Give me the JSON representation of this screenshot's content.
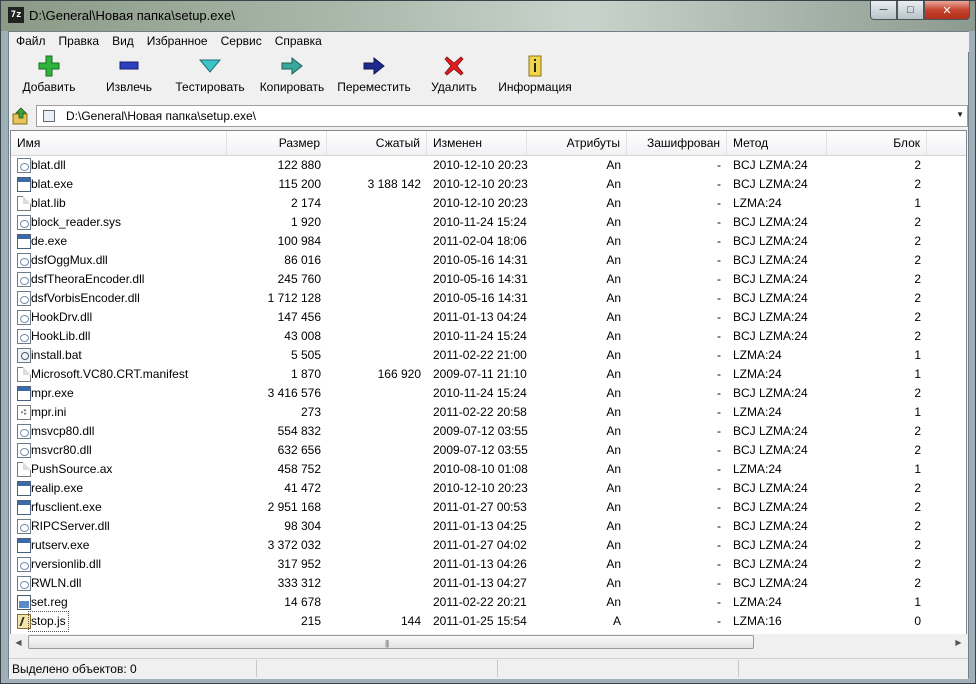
{
  "window": {
    "title": "D:\\General\\Новая папка\\setup.exe\\",
    "app_icon_text": "7z",
    "minimize": "─",
    "maximize": "□",
    "close": "✕"
  },
  "menu": [
    "Файл",
    "Правка",
    "Вид",
    "Избранное",
    "Сервис",
    "Справка"
  ],
  "toolbar": {
    "add": "Добавить",
    "extract": "Извлечь",
    "test": "Тестировать",
    "copy": "Копировать",
    "move": "Переместить",
    "delete": "Удалить",
    "info": "Информация"
  },
  "address": {
    "path": "D:\\General\\Новая папка\\setup.exe\\"
  },
  "columns": [
    "Имя",
    "Размер",
    "Сжатый",
    "Изменен",
    "Атрибуты",
    "Зашифрован",
    "Метод",
    "Блок"
  ],
  "files": [
    {
      "name": "blat.dll",
      "icon": "doc",
      "size": "122 880",
      "packed": "",
      "modified": "2010-12-10 20:23",
      "attr": "An",
      "enc": "-",
      "method": "BCJ LZMA:24",
      "block": "2"
    },
    {
      "name": "blat.exe",
      "icon": "exe",
      "size": "115 200",
      "packed": "3 188 142",
      "modified": "2010-12-10 20:23",
      "attr": "An",
      "enc": "-",
      "method": "BCJ LZMA:24",
      "block": "2"
    },
    {
      "name": "blat.lib",
      "icon": "plain",
      "size": "2 174",
      "packed": "",
      "modified": "2010-12-10 20:23",
      "attr": "An",
      "enc": "-",
      "method": "LZMA:24",
      "block": "1"
    },
    {
      "name": "block_reader.sys",
      "icon": "doc",
      "size": "1 920",
      "packed": "",
      "modified": "2010-11-24 15:24",
      "attr": "An",
      "enc": "-",
      "method": "BCJ LZMA:24",
      "block": "2"
    },
    {
      "name": "de.exe",
      "icon": "exe",
      "size": "100 984",
      "packed": "",
      "modified": "2011-02-04 18:06",
      "attr": "An",
      "enc": "-",
      "method": "BCJ LZMA:24",
      "block": "2"
    },
    {
      "name": "dsfOggMux.dll",
      "icon": "doc",
      "size": "86 016",
      "packed": "",
      "modified": "2010-05-16 14:31",
      "attr": "An",
      "enc": "-",
      "method": "BCJ LZMA:24",
      "block": "2"
    },
    {
      "name": "dsfTheoraEncoder.dll",
      "icon": "doc",
      "size": "245 760",
      "packed": "",
      "modified": "2010-05-16 14:31",
      "attr": "An",
      "enc": "-",
      "method": "BCJ LZMA:24",
      "block": "2"
    },
    {
      "name": "dsfVorbisEncoder.dll",
      "icon": "doc",
      "size": "1 712 128",
      "packed": "",
      "modified": "2010-05-16 14:31",
      "attr": "An",
      "enc": "-",
      "method": "BCJ LZMA:24",
      "block": "2"
    },
    {
      "name": "HookDrv.dll",
      "icon": "doc",
      "size": "147 456",
      "packed": "",
      "modified": "2011-01-13 04:24",
      "attr": "An",
      "enc": "-",
      "method": "BCJ LZMA:24",
      "block": "2"
    },
    {
      "name": "HookLib.dll",
      "icon": "doc",
      "size": "43 008",
      "packed": "",
      "modified": "2010-11-24 15:24",
      "attr": "An",
      "enc": "-",
      "method": "BCJ LZMA:24",
      "block": "2"
    },
    {
      "name": "install.bat",
      "icon": "bat",
      "size": "5 505",
      "packed": "",
      "modified": "2011-02-22 21:00",
      "attr": "An",
      "enc": "-",
      "method": "LZMA:24",
      "block": "1"
    },
    {
      "name": "Microsoft.VC80.CRT.manifest",
      "icon": "plain",
      "size": "1 870",
      "packed": "166 920",
      "modified": "2009-07-11 21:10",
      "attr": "An",
      "enc": "-",
      "method": "LZMA:24",
      "block": "1"
    },
    {
      "name": "mpr.exe",
      "icon": "exe",
      "size": "3 416 576",
      "packed": "",
      "modified": "2010-11-24 15:24",
      "attr": "An",
      "enc": "-",
      "method": "BCJ LZMA:24",
      "block": "2"
    },
    {
      "name": "mpr.ini",
      "icon": "ini",
      "size": "273",
      "packed": "",
      "modified": "2011-02-22 20:58",
      "attr": "An",
      "enc": "-",
      "method": "LZMA:24",
      "block": "1"
    },
    {
      "name": "msvcp80.dll",
      "icon": "doc",
      "size": "554 832",
      "packed": "",
      "modified": "2009-07-12 03:55",
      "attr": "An",
      "enc": "-",
      "method": "BCJ LZMA:24",
      "block": "2"
    },
    {
      "name": "msvcr80.dll",
      "icon": "doc",
      "size": "632 656",
      "packed": "",
      "modified": "2009-07-12 03:55",
      "attr": "An",
      "enc": "-",
      "method": "BCJ LZMA:24",
      "block": "2"
    },
    {
      "name": "PushSource.ax",
      "icon": "plain",
      "size": "458 752",
      "packed": "",
      "modified": "2010-08-10 01:08",
      "attr": "An",
      "enc": "-",
      "method": "LZMA:24",
      "block": "1"
    },
    {
      "name": "realip.exe",
      "icon": "exe",
      "size": "41 472",
      "packed": "",
      "modified": "2010-12-10 20:23",
      "attr": "An",
      "enc": "-",
      "method": "BCJ LZMA:24",
      "block": "2"
    },
    {
      "name": "rfusclient.exe",
      "icon": "exe",
      "size": "2 951 168",
      "packed": "",
      "modified": "2011-01-27 00:53",
      "attr": "An",
      "enc": "-",
      "method": "BCJ LZMA:24",
      "block": "2"
    },
    {
      "name": "RIPCServer.dll",
      "icon": "doc",
      "size": "98 304",
      "packed": "",
      "modified": "2011-01-13 04:25",
      "attr": "An",
      "enc": "-",
      "method": "BCJ LZMA:24",
      "block": "2"
    },
    {
      "name": "rutserv.exe",
      "icon": "exe",
      "size": "3 372 032",
      "packed": "",
      "modified": "2011-01-27 04:02",
      "attr": "An",
      "enc": "-",
      "method": "BCJ LZMA:24",
      "block": "2"
    },
    {
      "name": "rversionlib.dll",
      "icon": "doc",
      "size": "317 952",
      "packed": "",
      "modified": "2011-01-13 04:26",
      "attr": "An",
      "enc": "-",
      "method": "BCJ LZMA:24",
      "block": "2"
    },
    {
      "name": "RWLN.dll",
      "icon": "doc",
      "size": "333 312",
      "packed": "",
      "modified": "2011-01-13 04:27",
      "attr": "An",
      "enc": "-",
      "method": "BCJ LZMA:24",
      "block": "2"
    },
    {
      "name": "set.reg",
      "icon": "reg",
      "size": "14 678",
      "packed": "",
      "modified": "2011-02-22 20:21",
      "attr": "An",
      "enc": "-",
      "method": "LZMA:24",
      "block": "1"
    },
    {
      "name": "stop.js",
      "icon": "js",
      "size": "215",
      "packed": "144",
      "modified": "2011-01-25 15:54",
      "attr": "A",
      "enc": "-",
      "method": "LZMA:16",
      "block": "0"
    }
  ],
  "status": {
    "selected": "Выделено объектов: 0"
  }
}
